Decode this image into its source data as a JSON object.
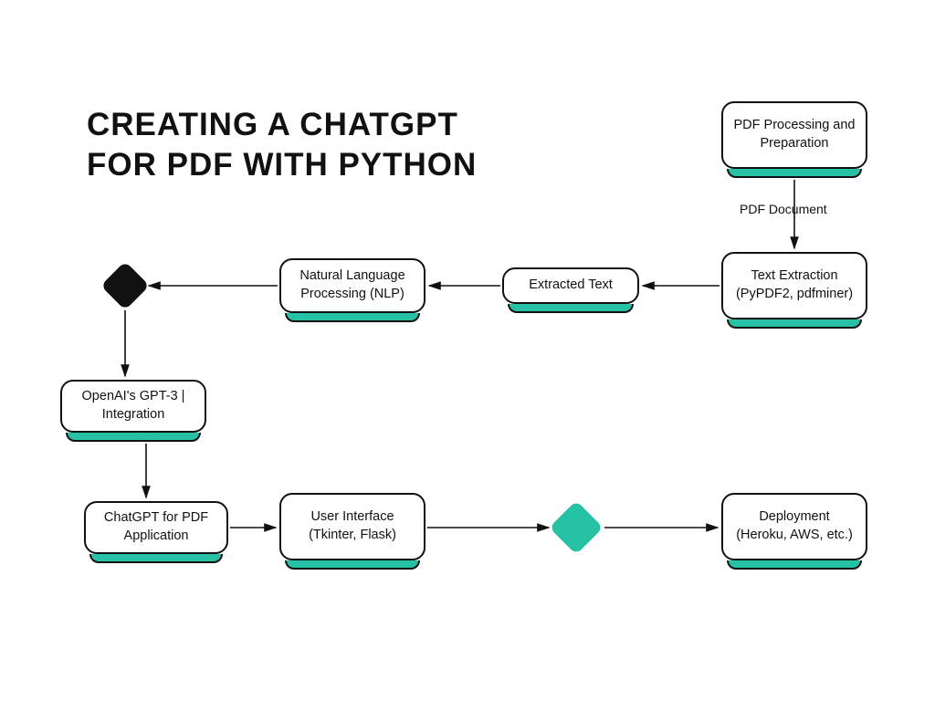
{
  "title": "CREATING A CHATGPT\nFOR PDF WITH PYTHON",
  "edges": {
    "pdf_document": "PDF  Document"
  },
  "nodes": {
    "pdf_processing": "PDF Processing and Preparation",
    "text_extraction": "Text Extraction (PyPDF2, pdfminer)",
    "extracted_text": "Extracted Text",
    "nlp": "Natural Language Processing  (NLP)",
    "gpt3": "OpenAI's GPT-3 | Integration",
    "app": "ChatGPT for PDF Application",
    "ui": "User Interface (Tkinter, Flask)",
    "deploy": "Deployment (Heroku, AWS, etc.)"
  },
  "accent_color": "#27C1A6"
}
